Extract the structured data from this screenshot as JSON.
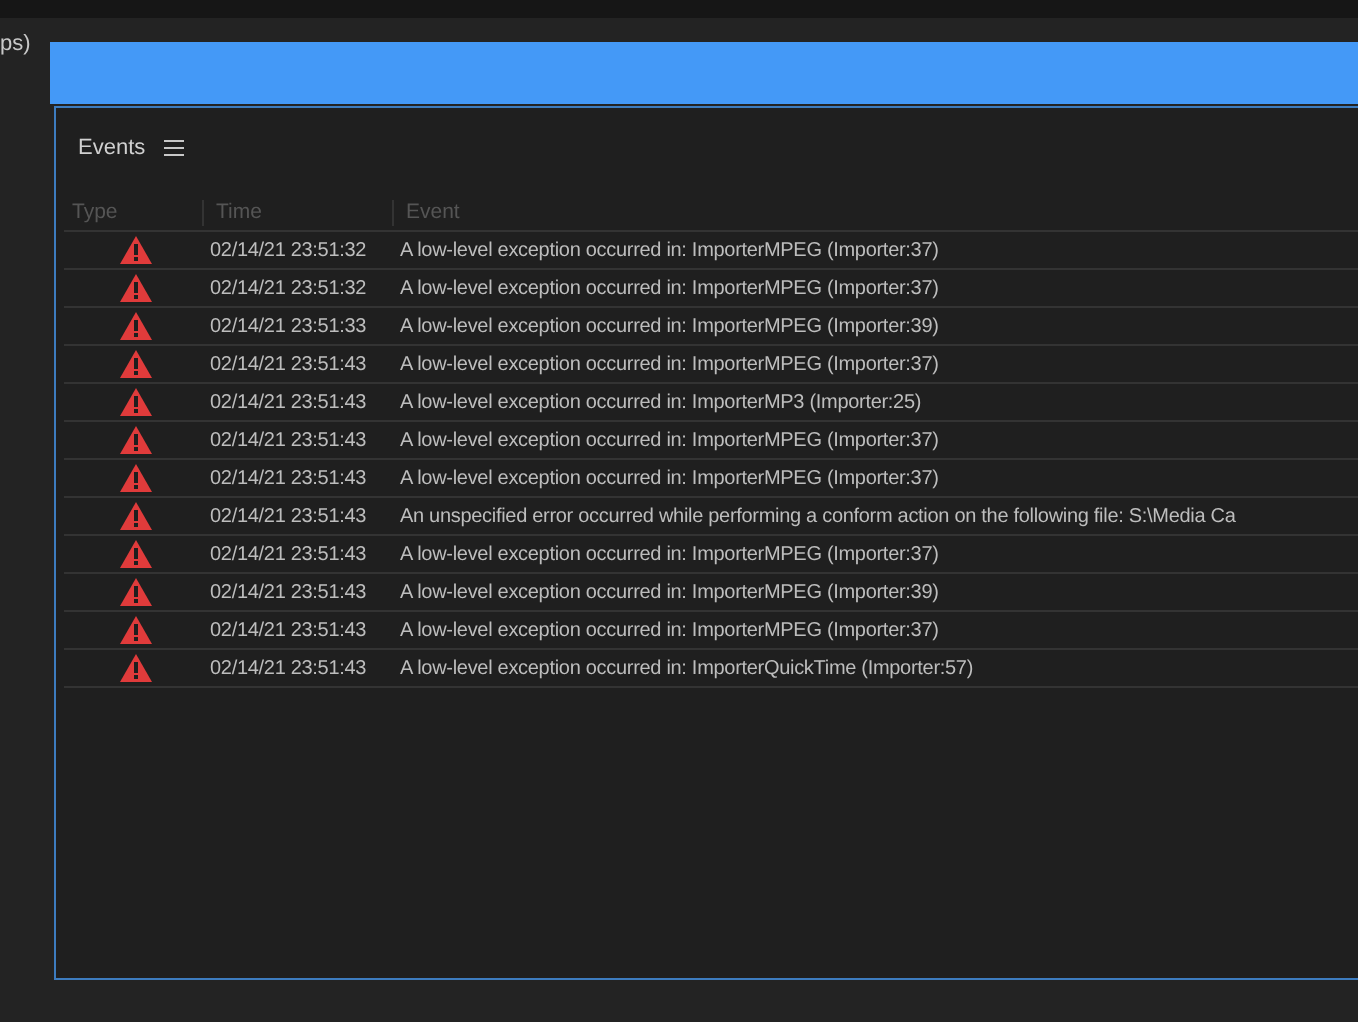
{
  "background_label": "ps)",
  "panel": {
    "title": "Events"
  },
  "table": {
    "columns": [
      "Type",
      "Time",
      "Event"
    ],
    "rows": [
      {
        "time": "02/14/21 23:51:32",
        "event": "A low-level exception occurred in: ImporterMPEG (Importer:37)"
      },
      {
        "time": "02/14/21 23:51:32",
        "event": "A low-level exception occurred in: ImporterMPEG (Importer:37)"
      },
      {
        "time": "02/14/21 23:51:33",
        "event": "A low-level exception occurred in: ImporterMPEG (Importer:39)"
      },
      {
        "time": "02/14/21 23:51:43",
        "event": "A low-level exception occurred in: ImporterMPEG (Importer:37)"
      },
      {
        "time": "02/14/21 23:51:43",
        "event": "A low-level exception occurred in: ImporterMP3 (Importer:25)"
      },
      {
        "time": "02/14/21 23:51:43",
        "event": "A low-level exception occurred in: ImporterMPEG (Importer:37)"
      },
      {
        "time": "02/14/21 23:51:43",
        "event": "A low-level exception occurred in: ImporterMPEG (Importer:37)"
      },
      {
        "time": "02/14/21 23:51:43",
        "event": "An unspecified error occurred while performing a conform action on the following file: S:\\Media Ca"
      },
      {
        "time": "02/14/21 23:51:43",
        "event": "A low-level exception occurred in: ImporterMPEG (Importer:37)"
      },
      {
        "time": "02/14/21 23:51:43",
        "event": "A low-level exception occurred in: ImporterMPEG (Importer:39)"
      },
      {
        "time": "02/14/21 23:51:43",
        "event": "A low-level exception occurred in: ImporterMPEG (Importer:37)"
      },
      {
        "time": "02/14/21 23:51:43",
        "event": "A low-level exception occurred in: ImporterQuickTime (Importer:57)"
      }
    ]
  }
}
